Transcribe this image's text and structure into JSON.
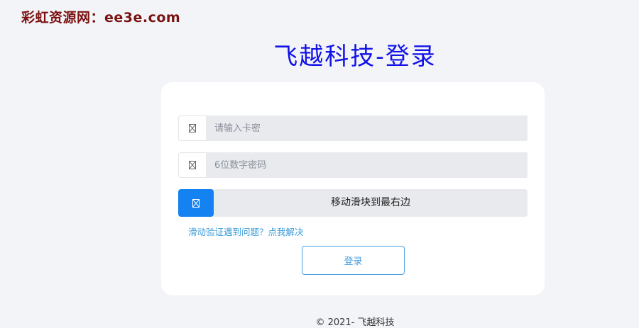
{
  "watermark": {
    "text": "彩虹资源网：ee3e.com"
  },
  "header": {
    "title": "飞越科技-登录"
  },
  "form": {
    "card_key": {
      "placeholder": "请输入卡密",
      "value": "",
      "icon": "broken-image-icon"
    },
    "password": {
      "placeholder": "6位数字密码",
      "value": "",
      "icon": "broken-image-icon"
    },
    "slider": {
      "label": "移动滑块到最右边",
      "icon": "broken-image-icon",
      "progress": 0
    },
    "help_link": "滑动验证遇到问题？点我解决",
    "submit_label": "登录"
  },
  "footer": {
    "text": "© 2021- 飞越科技"
  },
  "colors": {
    "page_bg": "#f3f4f8",
    "card_bg": "#ffffff",
    "title": "#1212e8",
    "watermark": "#7a1111",
    "accent": "#1482f0",
    "link": "#3b9ad8",
    "input_bg": "#e8eaee"
  }
}
